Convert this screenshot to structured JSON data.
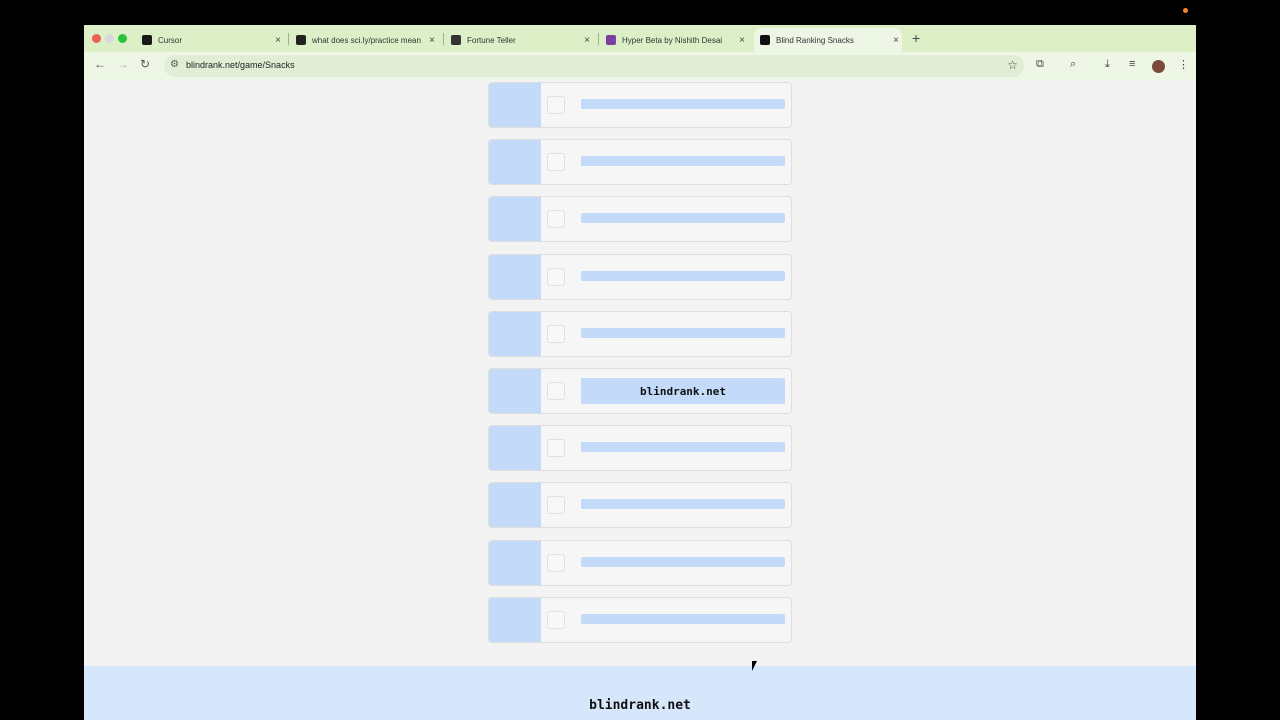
{
  "browser": {
    "tabs": [
      {
        "title": "Cursor",
        "favicon": "cursor-favicon",
        "favicon_color": "#1a1a1a",
        "active": false
      },
      {
        "title": "what does sci.ly/practice mean",
        "favicon": "notion-favicon",
        "favicon_color": "#222222",
        "active": false
      },
      {
        "title": "Fortune Teller",
        "favicon": "notion-favicon",
        "favicon_color": "#333333",
        "active": false
      },
      {
        "title": "Hyper Beta by Nishith Desai",
        "favicon": "music-note-favicon",
        "favicon_color": "#7b3fa0",
        "active": false
      },
      {
        "title": "Blind Ranking Snacks",
        "favicon": "blindrank-favicon",
        "favicon_color": "#111111",
        "active": true
      }
    ],
    "close_glyph": "×",
    "new_tab_glyph": "+",
    "url": "blindrank.net/game/Snacks"
  },
  "page": {
    "rows": [
      {
        "text": ""
      },
      {
        "text": ""
      },
      {
        "text": ""
      },
      {
        "text": ""
      },
      {
        "text": ""
      },
      {
        "text": "blindrank.net"
      },
      {
        "text": ""
      },
      {
        "text": ""
      },
      {
        "text": ""
      },
      {
        "text": ""
      }
    ],
    "footer_brand": "blindrank.net"
  },
  "colors": {
    "tab_bar": "#dcefc6",
    "toolbar": "#eef7e6",
    "placeholder": "#c3daf8",
    "footer": "#d6e6fb"
  }
}
